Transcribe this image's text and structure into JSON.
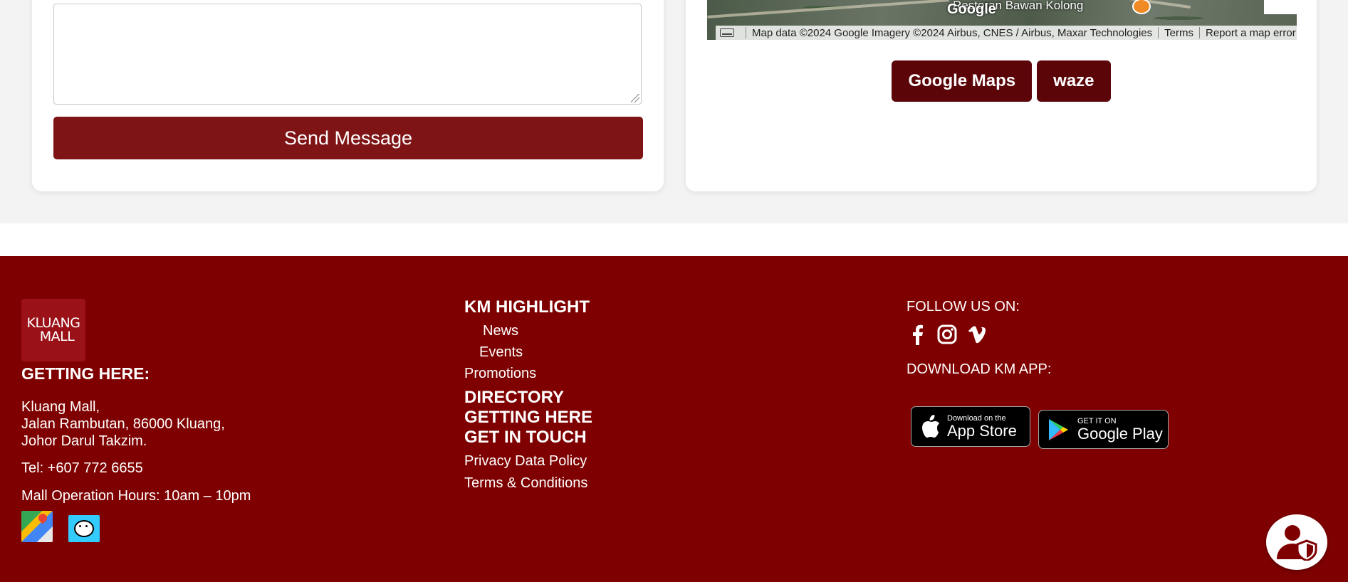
{
  "contact_form": {
    "message_placeholder": "",
    "send_label": "Send Message"
  },
  "map": {
    "place_label": "Restoran Bawan Kolong",
    "google_watermark": "Google",
    "attribution": "Map data ©2024 Google Imagery ©2024 Airbus, CNES / Airbus, Maxar Technologies",
    "terms": "Terms",
    "report": "Report a map error",
    "buttons": [
      "Google Maps",
      "waze"
    ]
  },
  "footer": {
    "logo_lines": [
      "KLUANG",
      "MALL"
    ],
    "getting_here_title": "GETTING HERE:",
    "address_lines": [
      "Kluang Mall,",
      "Jalan Rambutan, 86000 Kluang,",
      "Johor Darul Takzim."
    ],
    "tel": "Tel: +607 772 6655",
    "hours": "Mall Operation Hours: 10am – 10pm",
    "nav_icons": [
      "google-maps-icon",
      "waze-icon"
    ],
    "highlight_title": "KM HIGHLIGHT",
    "highlight_links": [
      "News",
      "Events",
      "Promotions"
    ],
    "directory_links": [
      "DIRECTORY",
      "GETTING HERE",
      "GET IN TOUCH"
    ],
    "policy_links": [
      "Privacy Data Policy",
      "Terms & Conditions"
    ],
    "follow_title": "FOLLOW US ON:",
    "socials": [
      "facebook-icon",
      "instagram-icon",
      "vimeo-icon"
    ],
    "download_title": "DOWNLOAD KM APP:",
    "app_store": {
      "small": "Download on the",
      "big": "App Store"
    },
    "play_store": {
      "small": "GET IT ON",
      "big": "Google Play"
    }
  },
  "colors": {
    "footer_bg": "#7f0000",
    "send_button": "#7e1416",
    "map_button": "#5b0509"
  }
}
